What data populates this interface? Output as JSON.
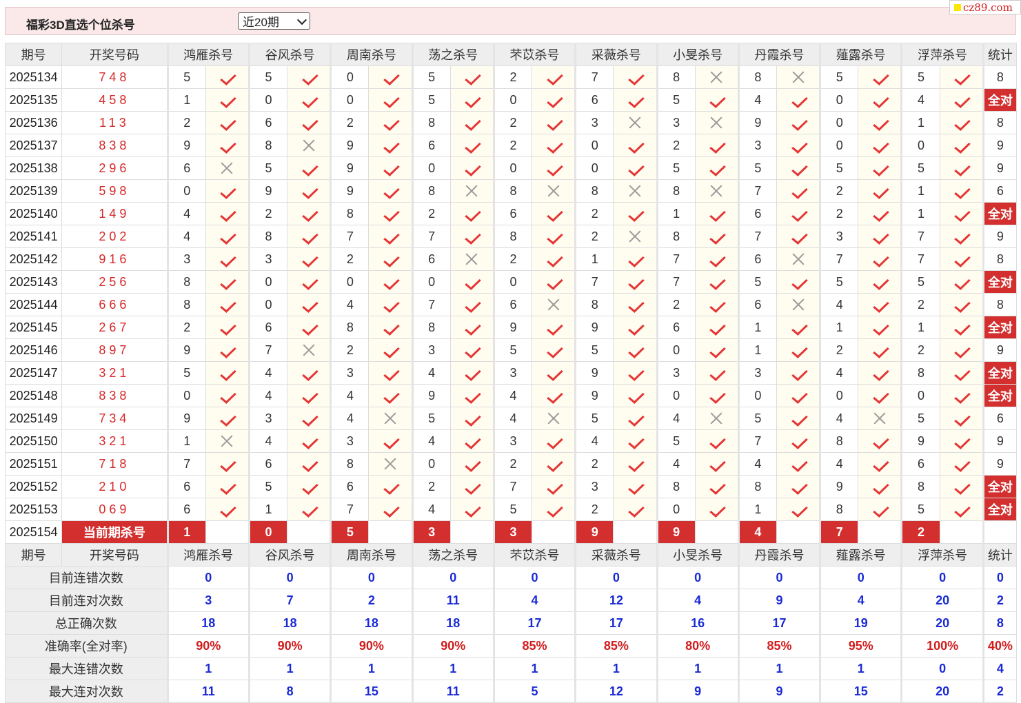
{
  "header": {
    "title": "福彩3D直选个位杀号",
    "period": "近20期"
  },
  "logo": "cz89.com",
  "table": {
    "headers": [
      "期号",
      "开奖号码",
      "鸿雁杀号",
      "谷风杀号",
      "周南杀号",
      "荡之杀号",
      "芣苡杀号",
      "采薇杀号",
      "小旻杀号",
      "丹霞杀号",
      "薤露杀号",
      "浮萍杀号",
      "统计"
    ],
    "rows": [
      {
        "issue": "2025134",
        "draw": "748",
        "kills": [
          [
            "5",
            1
          ],
          [
            "5",
            1
          ],
          [
            "0",
            1
          ],
          [
            "5",
            1
          ],
          [
            "2",
            1
          ],
          [
            "7",
            1
          ],
          [
            "8",
            0
          ],
          [
            "8",
            0
          ],
          [
            "5",
            1
          ],
          [
            "5",
            1
          ]
        ],
        "stat": "8"
      },
      {
        "issue": "2025135",
        "draw": "458",
        "kills": [
          [
            "1",
            1
          ],
          [
            "0",
            1
          ],
          [
            "0",
            1
          ],
          [
            "5",
            1
          ],
          [
            "0",
            1
          ],
          [
            "6",
            1
          ],
          [
            "5",
            1
          ],
          [
            "4",
            1
          ],
          [
            "0",
            1
          ],
          [
            "4",
            1
          ]
        ],
        "stat": "全对"
      },
      {
        "issue": "2025136",
        "draw": "113",
        "kills": [
          [
            "2",
            1
          ],
          [
            "6",
            1
          ],
          [
            "2",
            1
          ],
          [
            "8",
            1
          ],
          [
            "2",
            1
          ],
          [
            "3",
            0
          ],
          [
            "3",
            0
          ],
          [
            "9",
            1
          ],
          [
            "0",
            1
          ],
          [
            "1",
            1
          ]
        ],
        "stat": "8"
      },
      {
        "issue": "2025137",
        "draw": "838",
        "kills": [
          [
            "9",
            1
          ],
          [
            "8",
            0
          ],
          [
            "9",
            1
          ],
          [
            "6",
            1
          ],
          [
            "2",
            1
          ],
          [
            "0",
            1
          ],
          [
            "2",
            1
          ],
          [
            "3",
            1
          ],
          [
            "0",
            1
          ],
          [
            "0",
            1
          ]
        ],
        "stat": "9"
      },
      {
        "issue": "2025138",
        "draw": "296",
        "kills": [
          [
            "6",
            0
          ],
          [
            "5",
            1
          ],
          [
            "9",
            1
          ],
          [
            "0",
            1
          ],
          [
            "0",
            1
          ],
          [
            "0",
            1
          ],
          [
            "5",
            1
          ],
          [
            "5",
            1
          ],
          [
            "5",
            1
          ],
          [
            "5",
            1
          ]
        ],
        "stat": "9"
      },
      {
        "issue": "2025139",
        "draw": "598",
        "kills": [
          [
            "0",
            1
          ],
          [
            "9",
            1
          ],
          [
            "9",
            1
          ],
          [
            "8",
            0
          ],
          [
            "8",
            0
          ],
          [
            "8",
            0
          ],
          [
            "8",
            0
          ],
          [
            "7",
            1
          ],
          [
            "2",
            1
          ],
          [
            "1",
            1
          ]
        ],
        "stat": "6"
      },
      {
        "issue": "2025140",
        "draw": "149",
        "kills": [
          [
            "4",
            1
          ],
          [
            "2",
            1
          ],
          [
            "8",
            1
          ],
          [
            "2",
            1
          ],
          [
            "6",
            1
          ],
          [
            "2",
            1
          ],
          [
            "1",
            1
          ],
          [
            "6",
            1
          ],
          [
            "2",
            1
          ],
          [
            "1",
            1
          ]
        ],
        "stat": "全对"
      },
      {
        "issue": "2025141",
        "draw": "202",
        "kills": [
          [
            "4",
            1
          ],
          [
            "8",
            1
          ],
          [
            "7",
            1
          ],
          [
            "7",
            1
          ],
          [
            "8",
            1
          ],
          [
            "2",
            0
          ],
          [
            "8",
            1
          ],
          [
            "7",
            1
          ],
          [
            "3",
            1
          ],
          [
            "7",
            1
          ]
        ],
        "stat": "9"
      },
      {
        "issue": "2025142",
        "draw": "916",
        "kills": [
          [
            "3",
            1
          ],
          [
            "3",
            1
          ],
          [
            "2",
            1
          ],
          [
            "6",
            0
          ],
          [
            "2",
            1
          ],
          [
            "1",
            1
          ],
          [
            "7",
            1
          ],
          [
            "6",
            0
          ],
          [
            "7",
            1
          ],
          [
            "7",
            1
          ]
        ],
        "stat": "8"
      },
      {
        "issue": "2025143",
        "draw": "256",
        "kills": [
          [
            "8",
            1
          ],
          [
            "0",
            1
          ],
          [
            "0",
            1
          ],
          [
            "0",
            1
          ],
          [
            "0",
            1
          ],
          [
            "7",
            1
          ],
          [
            "7",
            1
          ],
          [
            "5",
            1
          ],
          [
            "5",
            1
          ],
          [
            "5",
            1
          ]
        ],
        "stat": "全对"
      },
      {
        "issue": "2025144",
        "draw": "666",
        "kills": [
          [
            "8",
            1
          ],
          [
            "0",
            1
          ],
          [
            "4",
            1
          ],
          [
            "7",
            1
          ],
          [
            "6",
            0
          ],
          [
            "8",
            1
          ],
          [
            "2",
            1
          ],
          [
            "6",
            0
          ],
          [
            "4",
            1
          ],
          [
            "2",
            1
          ]
        ],
        "stat": "8"
      },
      {
        "issue": "2025145",
        "draw": "267",
        "kills": [
          [
            "2",
            1
          ],
          [
            "6",
            1
          ],
          [
            "8",
            1
          ],
          [
            "8",
            1
          ],
          [
            "9",
            1
          ],
          [
            "9",
            1
          ],
          [
            "6",
            1
          ],
          [
            "1",
            1
          ],
          [
            "1",
            1
          ],
          [
            "1",
            1
          ]
        ],
        "stat": "全对"
      },
      {
        "issue": "2025146",
        "draw": "897",
        "kills": [
          [
            "9",
            1
          ],
          [
            "7",
            0
          ],
          [
            "2",
            1
          ],
          [
            "3",
            1
          ],
          [
            "5",
            1
          ],
          [
            "5",
            1
          ],
          [
            "0",
            1
          ],
          [
            "1",
            1
          ],
          [
            "2",
            1
          ],
          [
            "2",
            1
          ]
        ],
        "stat": "9"
      },
      {
        "issue": "2025147",
        "draw": "321",
        "kills": [
          [
            "5",
            1
          ],
          [
            "4",
            1
          ],
          [
            "3",
            1
          ],
          [
            "4",
            1
          ],
          [
            "3",
            1
          ],
          [
            "9",
            1
          ],
          [
            "3",
            1
          ],
          [
            "3",
            1
          ],
          [
            "4",
            1
          ],
          [
            "8",
            1
          ]
        ],
        "stat": "全对"
      },
      {
        "issue": "2025148",
        "draw": "838",
        "kills": [
          [
            "0",
            1
          ],
          [
            "4",
            1
          ],
          [
            "4",
            1
          ],
          [
            "9",
            1
          ],
          [
            "4",
            1
          ],
          [
            "9",
            1
          ],
          [
            "0",
            1
          ],
          [
            "0",
            1
          ],
          [
            "0",
            1
          ],
          [
            "0",
            1
          ]
        ],
        "stat": "全对"
      },
      {
        "issue": "2025149",
        "draw": "734",
        "kills": [
          [
            "9",
            1
          ],
          [
            "3",
            1
          ],
          [
            "4",
            0
          ],
          [
            "5",
            1
          ],
          [
            "4",
            0
          ],
          [
            "5",
            1
          ],
          [
            "4",
            0
          ],
          [
            "5",
            1
          ],
          [
            "4",
            0
          ],
          [
            "5",
            1
          ]
        ],
        "stat": "6"
      },
      {
        "issue": "2025150",
        "draw": "321",
        "kills": [
          [
            "1",
            0
          ],
          [
            "4",
            1
          ],
          [
            "3",
            1
          ],
          [
            "4",
            1
          ],
          [
            "3",
            1
          ],
          [
            "4",
            1
          ],
          [
            "5",
            1
          ],
          [
            "7",
            1
          ],
          [
            "8",
            1
          ],
          [
            "9",
            1
          ]
        ],
        "stat": "9"
      },
      {
        "issue": "2025151",
        "draw": "718",
        "kills": [
          [
            "7",
            1
          ],
          [
            "6",
            1
          ],
          [
            "8",
            0
          ],
          [
            "0",
            1
          ],
          [
            "2",
            1
          ],
          [
            "2",
            1
          ],
          [
            "4",
            1
          ],
          [
            "4",
            1
          ],
          [
            "4",
            1
          ],
          [
            "6",
            1
          ]
        ],
        "stat": "9"
      },
      {
        "issue": "2025152",
        "draw": "210",
        "kills": [
          [
            "6",
            1
          ],
          [
            "5",
            1
          ],
          [
            "6",
            1
          ],
          [
            "2",
            1
          ],
          [
            "7",
            1
          ],
          [
            "3",
            1
          ],
          [
            "8",
            1
          ],
          [
            "8",
            1
          ],
          [
            "9",
            1
          ],
          [
            "8",
            1
          ]
        ],
        "stat": "全对"
      },
      {
        "issue": "2025153",
        "draw": "069",
        "kills": [
          [
            "6",
            1
          ],
          [
            "1",
            1
          ],
          [
            "7",
            1
          ],
          [
            "4",
            1
          ],
          [
            "5",
            1
          ],
          [
            "2",
            1
          ],
          [
            "0",
            1
          ],
          [
            "1",
            1
          ],
          [
            "8",
            1
          ],
          [
            "5",
            1
          ]
        ],
        "stat": "全对"
      }
    ],
    "current": {
      "issue": "2025154",
      "label": "当前期杀号",
      "kills": [
        "1",
        "0",
        "5",
        "3",
        "3",
        "9",
        "9",
        "4",
        "7",
        "2"
      ]
    },
    "stats": [
      {
        "label": "目前连错次数",
        "values": [
          "0",
          "0",
          "0",
          "0",
          "0",
          "0",
          "0",
          "0",
          "0",
          "0",
          "0"
        ],
        "red": false
      },
      {
        "label": "目前连对次数",
        "values": [
          "3",
          "7",
          "2",
          "11",
          "4",
          "12",
          "4",
          "9",
          "4",
          "20",
          "2"
        ],
        "red": false
      },
      {
        "label": "总正确次数",
        "values": [
          "18",
          "18",
          "18",
          "18",
          "17",
          "17",
          "16",
          "17",
          "19",
          "20",
          "8"
        ],
        "red": false
      },
      {
        "label": "准确率(全对率)",
        "values": [
          "90%",
          "90%",
          "90%",
          "90%",
          "85%",
          "85%",
          "80%",
          "85%",
          "95%",
          "100%",
          "40%"
        ],
        "red": true
      },
      {
        "label": "最大连错次数",
        "values": [
          "1",
          "1",
          "1",
          "1",
          "1",
          "1",
          "1",
          "1",
          "1",
          "0",
          "4"
        ],
        "red": false
      },
      {
        "label": "最大连对次数",
        "values": [
          "11",
          "8",
          "15",
          "11",
          "5",
          "12",
          "9",
          "9",
          "15",
          "20",
          "2"
        ],
        "red": false
      }
    ]
  },
  "icons": {
    "correct": "check-icon",
    "wrong": "cross-icon"
  },
  "colors": {
    "accent_red": "#d32f2f",
    "check_red": "#e53535",
    "stat_blue": "#1a2ad6",
    "header_bg": "#fbe9e9"
  }
}
